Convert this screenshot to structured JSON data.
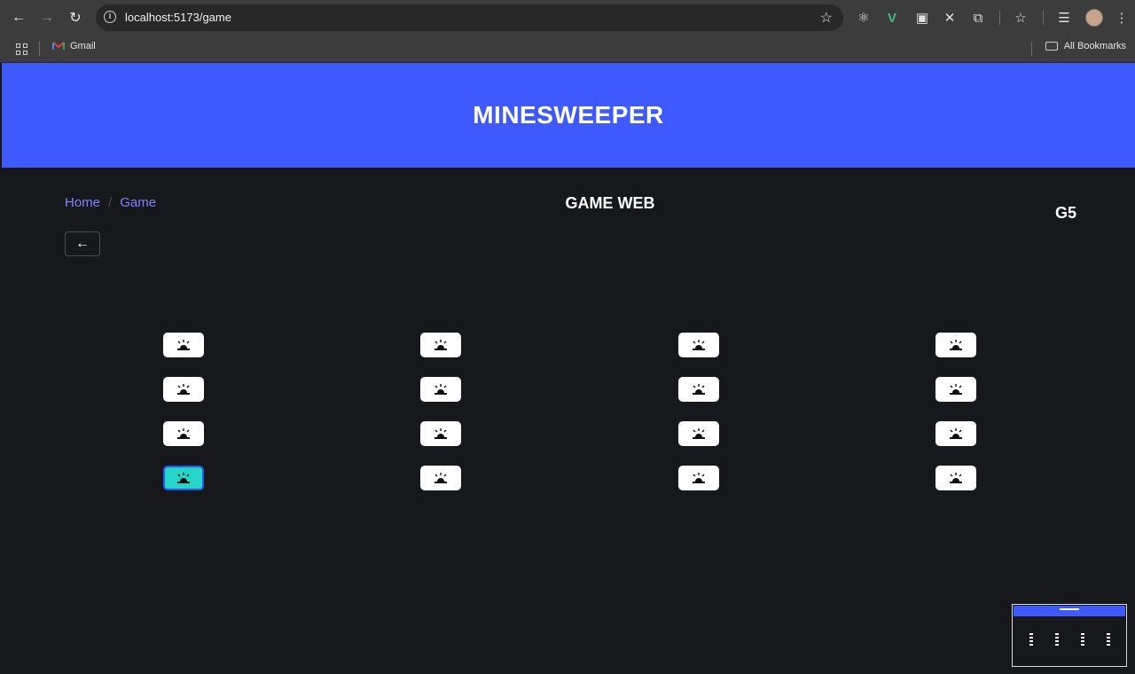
{
  "browser": {
    "url": "localhost:5173/game",
    "bookmarks": [
      {
        "label": "Gmail"
      }
    ],
    "all_bookmarks_label": "All Bookmarks"
  },
  "app": {
    "title": "MINESWEEPER"
  },
  "breadcrumb": {
    "home": "Home",
    "separator": "/",
    "current": "Game"
  },
  "page": {
    "title": "GAME WEB",
    "level": "G5"
  },
  "board": {
    "rows": 4,
    "columns": 4,
    "cell_icon": "alarm-icon",
    "selected_cell": {
      "row": 4,
      "column": 1
    },
    "colors": {
      "cell": "#ffffff",
      "selected": "#25d5c7",
      "selected_border": "#2a57f0",
      "banner": "#3e5afe",
      "background": "#17181c",
      "link": "#7d84ff"
    }
  }
}
